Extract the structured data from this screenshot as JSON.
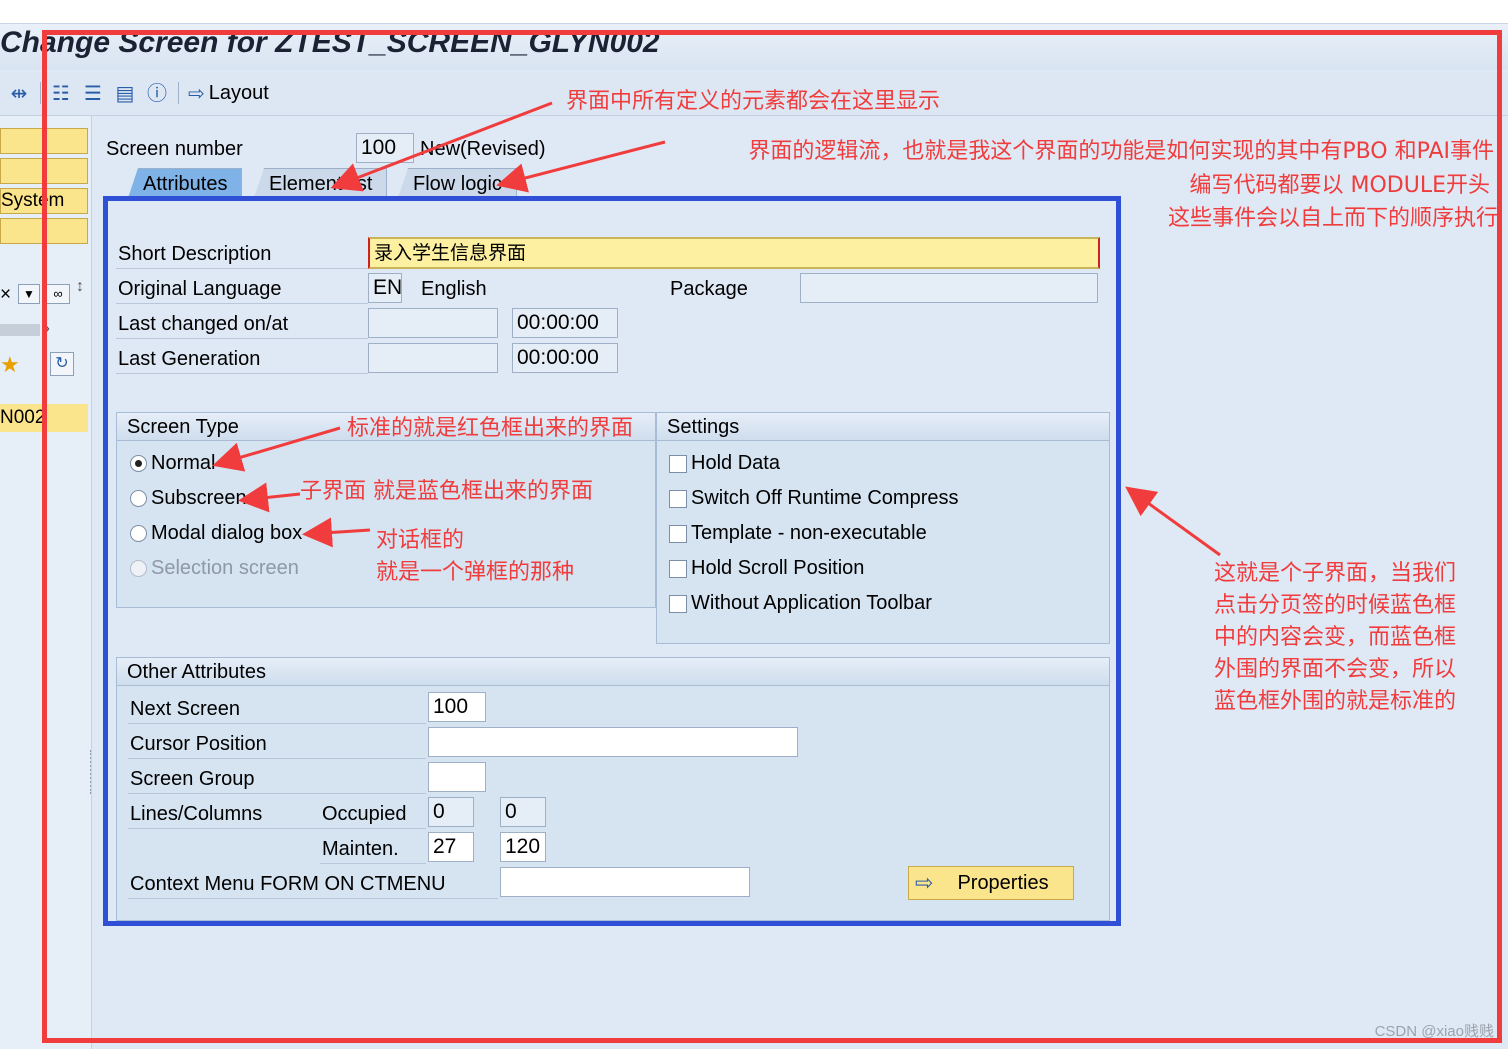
{
  "window": {
    "title": "Change Screen for ZTEST_SCREEN_GLYN002"
  },
  "toolbar": {
    "layout_label": "Layout",
    "icons": [
      "other-object-icon",
      "hierarchy-icon",
      "stack-icon",
      "list-icon",
      "info-icon",
      "arrow-right-icon"
    ]
  },
  "leftnav": {
    "system_label": "System",
    "item_label": "N002"
  },
  "header": {
    "screen_number_label": "Screen number",
    "screen_number": "100",
    "status": "New(Revised)"
  },
  "tabs": [
    {
      "label": "Attributes",
      "active": true
    },
    {
      "label": "Element list",
      "active": false
    },
    {
      "label": "Flow logic",
      "active": false
    }
  ],
  "attributes": {
    "short_description_label": "Short Description",
    "short_description_value": "录入学生信息界面",
    "original_language_label": "Original Language",
    "language_code": "EN",
    "language_name": "English",
    "package_label": "Package",
    "package_value": "",
    "last_changed_label": "Last changed on/at",
    "last_changed_date": "",
    "last_changed_time": "00:00:00",
    "last_generation_label": "Last Generation",
    "last_generation_date": "",
    "last_generation_time": "00:00:00"
  },
  "screen_type": {
    "title": "Screen Type",
    "options": [
      {
        "label": "Normal",
        "selected": true,
        "enabled": true
      },
      {
        "label": "Subscreen",
        "selected": false,
        "enabled": true
      },
      {
        "label": "Modal dialog box",
        "selected": false,
        "enabled": true
      },
      {
        "label": "Selection screen",
        "selected": false,
        "enabled": false
      }
    ]
  },
  "settings": {
    "title": "Settings",
    "options": [
      {
        "label": "Hold Data",
        "checked": false
      },
      {
        "label": "Switch Off Runtime Compress",
        "checked": false
      },
      {
        "label": "Template - non-executable",
        "checked": false
      },
      {
        "label": "Hold Scroll Position",
        "checked": false
      },
      {
        "label": "Without Application Toolbar",
        "checked": false
      }
    ]
  },
  "other_attributes": {
    "title": "Other Attributes",
    "next_screen_label": "Next Screen",
    "next_screen": "100",
    "cursor_position_label": "Cursor Position",
    "cursor_position": "",
    "screen_group_label": "Screen Group",
    "screen_group": "",
    "lines_columns_label": "Lines/Columns",
    "occupied_label": "Occupied",
    "occupied_lines": "0",
    "occupied_columns": "0",
    "mainten_label": "Mainten.",
    "mainten_lines": "27",
    "mainten_columns": "120",
    "context_menu_label": "Context Menu FORM ON CTMENU",
    "context_menu": "",
    "properties_label": "Properties"
  },
  "annotations": {
    "element_list_note": "界面中所有定义的元素都会在这里显示",
    "flow_logic_note_1": "界面的逻辑流，也就是我这个界面的功能是如何实现的其中有PBO 和PAI事件",
    "flow_logic_note_2": "编写代码都要以 MODULE开头",
    "flow_logic_note_3": "这些事件会以自上而下的顺序执行",
    "normal_note": "标准的就是红色框出来的界面",
    "subscreen_note": "子界面 就是蓝色框出来的界面",
    "modal_note_1": "对话框的",
    "modal_note_2": "就是一个弹框的那种",
    "side_note_1": "这就是个子界面，当我们",
    "side_note_2": "点击分页签的时候蓝色框",
    "side_note_3": "中的内容会变，而蓝色框",
    "side_note_4": "外围的界面不会变，所以",
    "side_note_5": "蓝色框外围的就是标准的"
  },
  "watermark": "CSDN @xiao贱贱",
  "colors": {
    "annotation_red": "#f03c3c",
    "subscreen_blue": "#2f4fd6",
    "required_field_yellow": "#fdf0a0",
    "active_tab_blue": "#7fb2e6"
  }
}
